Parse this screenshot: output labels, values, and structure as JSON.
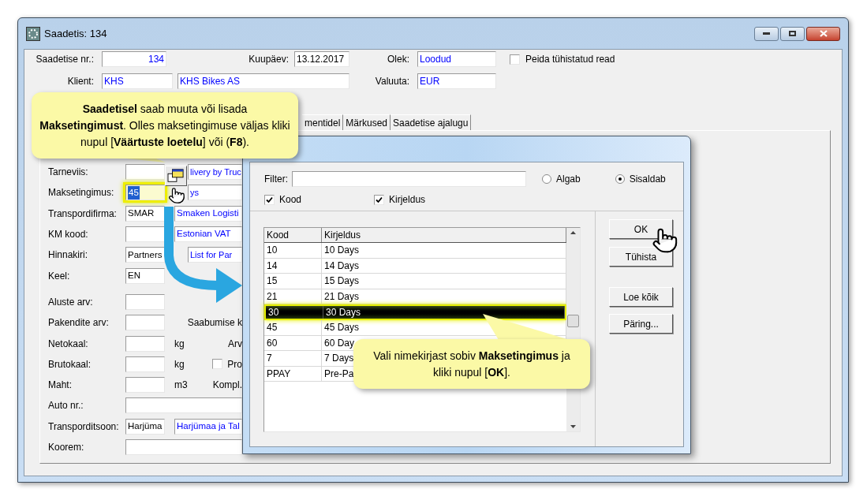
{
  "window": {
    "title": "Saadetis: 134"
  },
  "header": {
    "number": {
      "label": "Saadetise nr.:",
      "value": "134",
      "lookup": true
    },
    "date": {
      "label": "Kuupäev:",
      "value": "13.12.2017",
      "lookup": false
    },
    "status": {
      "label": "Olek:",
      "value": "Loodud",
      "lookup": true
    },
    "hide_cancelled": {
      "label": "Peida tühistatud read",
      "checked": false
    },
    "client": {
      "label": "Klient:",
      "code": {
        "value": "KHS",
        "lookup": true
      },
      "name": {
        "value": "KHS Bikes AS",
        "lookup": true
      }
    },
    "currency": {
      "label": "Valuuta:",
      "value": "EUR",
      "lookup": true
    }
  },
  "tabs": [
    {
      "label": "mentidel",
      "selected": false
    },
    {
      "label": "Märkused",
      "selected": false
    },
    {
      "label": "Saadetise ajalugu",
      "selected": false
    }
  ],
  "form_sections": [
    {
      "rows": [
        {
          "label": "Tarneviis:",
          "fields": [
            {
              "kind": "code"
            },
            {
              "kind": "covered",
              "value": "livery by Truc",
              "lookup": true
            }
          ]
        },
        {
          "label": "Maksetingimus:",
          "fields": [
            {
              "kind": "code",
              "value": "45",
              "highlighted": true
            },
            {
              "kind": "covered",
              "value": "ys",
              "lookup": true
            }
          ]
        },
        {
          "label": "Transpordifirma:",
          "fields": [
            {
              "kind": "code",
              "value": "SMAR",
              "lookup": false
            },
            {
              "kind": "name",
              "value": "Smaken Logisti",
              "lookup": true
            }
          ]
        },
        {
          "label": "KM kood:",
          "fields": [
            {
              "kind": "code"
            },
            {
              "kind": "name",
              "value": "Estonian VAT",
              "lookup": true
            }
          ]
        },
        {
          "label": "Hinnakiri:",
          "fields": [
            {
              "kind": "code",
              "value": "Partners",
              "lookup": false
            },
            {
              "kind": "covered",
              "value": "List for Par",
              "lookup": true
            }
          ]
        },
        {
          "label": "Keel:",
          "fields": [
            {
              "kind": "code",
              "value": "EN",
              "lookup": false
            }
          ]
        }
      ]
    },
    {
      "rows": [
        {
          "label": "Aluste arv:",
          "fields": [
            {
              "kind": "code"
            }
          ]
        },
        {
          "label": "Pakendite arv:",
          "fields": [
            {
              "kind": "code"
            }
          ],
          "extras": [
            {
              "kind": "label",
              "text": "Saabumise k"
            }
          ]
        },
        {
          "label": "Netokaal:",
          "fields": [
            {
              "kind": "code"
            }
          ],
          "extras": [
            {
              "kind": "unit",
              "text": "kg"
            },
            {
              "kind": "label",
              "text": "Arv"
            }
          ]
        },
        {
          "label": "Brutokaal:",
          "fields": [
            {
              "kind": "code"
            }
          ],
          "extras": [
            {
              "kind": "unit",
              "text": "kg"
            },
            {
              "kind": "checkbox",
              "text": "Pro",
              "checked": false
            }
          ]
        },
        {
          "label": "Maht:",
          "fields": [
            {
              "kind": "code"
            }
          ],
          "extras": [
            {
              "kind": "unit",
              "text": "m3"
            },
            {
              "kind": "label",
              "text": "Kompl."
            }
          ]
        },
        {
          "label": "Auto nr.:",
          "fields": [
            {
              "kind": "wide"
            }
          ]
        },
        {
          "label": "Transporditsoon:",
          "fields": [
            {
              "kind": "code",
              "value": "Harjüma",
              "lookup": false
            },
            {
              "kind": "name",
              "value": "Harjümaa ja Tal",
              "lookup": true
            }
          ]
        },
        {
          "label": "Koorem:",
          "fields": [
            {
              "kind": "wide"
            }
          ]
        }
      ]
    }
  ],
  "dialog": {
    "filter": {
      "label": "Filter:"
    },
    "match_modes": [
      {
        "label": "Algab",
        "selected": false
      },
      {
        "label": "Sisaldab",
        "selected": true
      }
    ],
    "search_in": [
      {
        "label": "Kood",
        "checked": true
      },
      {
        "label": "Kirjeldus",
        "checked": true
      }
    ],
    "table": {
      "columns": [
        "Kood",
        "Kirjeldus"
      ],
      "rows": [
        {
          "cells": [
            "10",
            "10 Days"
          ],
          "selected": false
        },
        {
          "cells": [
            "14",
            "14 Days"
          ],
          "selected": false
        },
        {
          "cells": [
            "15",
            "15 Days"
          ],
          "selected": false
        },
        {
          "cells": [
            "21",
            "21 Days"
          ],
          "selected": false
        },
        {
          "cells": [
            "30",
            "30 Days"
          ],
          "selected": true
        },
        {
          "cells": [
            "45",
            "45 Days"
          ],
          "selected": false
        },
        {
          "cells": [
            "60",
            "60 Day"
          ],
          "selected": false
        },
        {
          "cells": [
            "7",
            "7 Days"
          ],
          "selected": false
        },
        {
          "cells": [
            "PPAY",
            "Pre-Pa"
          ],
          "selected": false
        }
      ]
    },
    "buttons": [
      {
        "label": "OK"
      },
      {
        "label": "Tühista"
      },
      {
        "label": "Loe kõik"
      },
      {
        "label": "Päring..."
      }
    ]
  },
  "callouts": [
    {
      "text": "**Saadetisel** saab muuta või lisada **Maksetingimust**. Olles maksetingimuse väljas kliki nupul [**Väärtuste loetelu**] või (**F8**)."
    },
    {
      "text": "Vali nimekirjast sobiv **Maksetingimus** ja kliki nupul [**OK**]."
    }
  ]
}
